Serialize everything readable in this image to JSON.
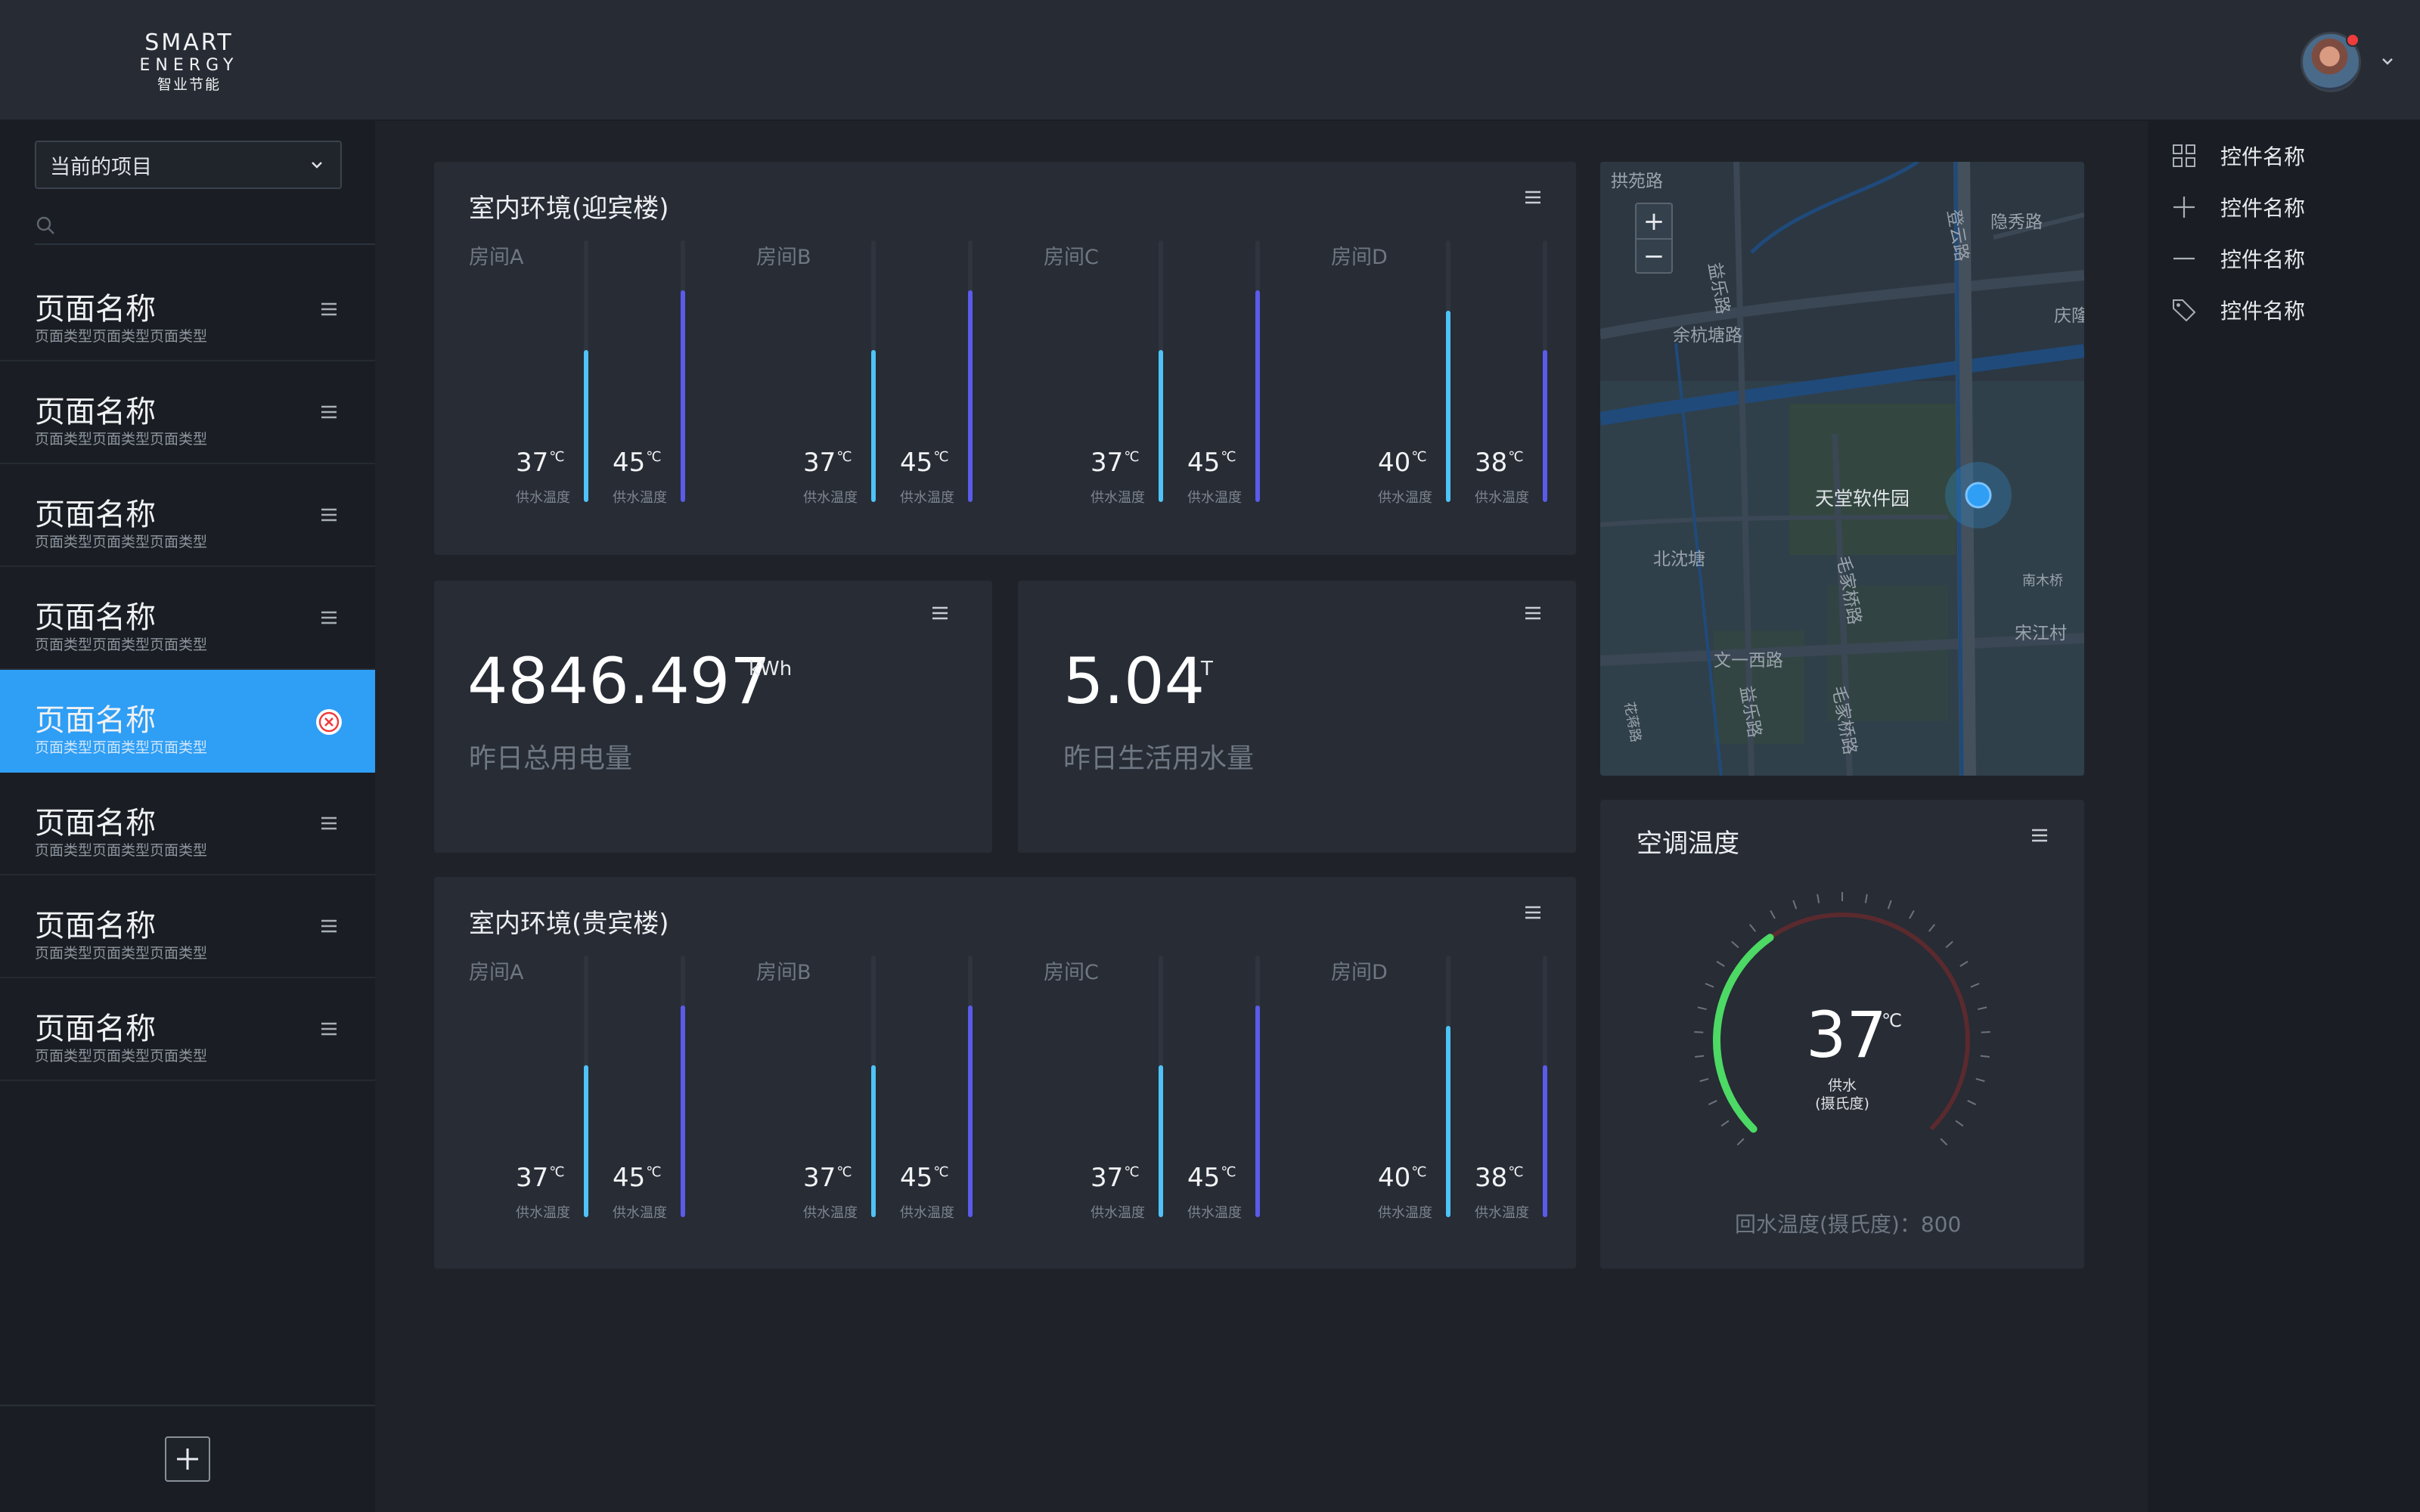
{
  "brand": {
    "line1": "SMART",
    "line2": "ENERGY",
    "line3": "智业节能"
  },
  "sidebar": {
    "project_select": "当前的项目",
    "search_placeholder": "",
    "items": [
      {
        "title": "页面名称",
        "subtitle": "页面类型页面类型页面类型"
      },
      {
        "title": "页面名称",
        "subtitle": "页面类型页面类型页面类型"
      },
      {
        "title": "页面名称",
        "subtitle": "页面类型页面类型页面类型"
      },
      {
        "title": "页面名称",
        "subtitle": "页面类型页面类型页面类型"
      },
      {
        "title": "页面名称",
        "subtitle": "页面类型页面类型页面类型",
        "active": true
      },
      {
        "title": "页面名称",
        "subtitle": "页面类型页面类型页面类型"
      },
      {
        "title": "页面名称",
        "subtitle": "页面类型页面类型页面类型"
      },
      {
        "title": "页面名称",
        "subtitle": "页面类型页面类型页面类型"
      }
    ]
  },
  "right_panel": {
    "items": [
      {
        "icon": "grid-icon",
        "label": "控件名称"
      },
      {
        "icon": "plus-icon",
        "label": "控件名称"
      },
      {
        "icon": "minus-icon",
        "label": "控件名称"
      },
      {
        "icon": "tag-icon",
        "label": "控件名称"
      }
    ]
  },
  "env_top": {
    "title": "室内环境(迎宾楼)",
    "rooms": [
      {
        "name": "房间A",
        "v1": "37",
        "v2": "45",
        "l1": "供水温度",
        "l2": "供水温度",
        "f1": 0.58,
        "f2": 0.81
      },
      {
        "name": "房间B",
        "v1": "37",
        "v2": "45",
        "l1": "供水温度",
        "l2": "供水温度",
        "f1": 0.58,
        "f2": 0.81
      },
      {
        "name": "房间C",
        "v1": "37",
        "v2": "45",
        "l1": "供水温度",
        "l2": "供水温度",
        "f1": 0.58,
        "f2": 0.81
      },
      {
        "name": "房间D",
        "v1": "40",
        "v2": "38",
        "l1": "供水温度",
        "l2": "供水温度",
        "f1": 0.73,
        "f2": 0.58
      }
    ]
  },
  "env_bottom": {
    "title": "室内环境(贵宾楼)",
    "rooms": [
      {
        "name": "房间A",
        "v1": "37",
        "v2": "45",
        "l1": "供水温度",
        "l2": "供水温度",
        "f1": 0.58,
        "f2": 0.81
      },
      {
        "name": "房间B",
        "v1": "37",
        "v2": "45",
        "l1": "供水温度",
        "l2": "供水温度",
        "f1": 0.58,
        "f2": 0.81
      },
      {
        "name": "房间C",
        "v1": "37",
        "v2": "45",
        "l1": "供水温度",
        "l2": "供水温度",
        "f1": 0.58,
        "f2": 0.81
      },
      {
        "name": "房间D",
        "v1": "40",
        "v2": "38",
        "l1": "供水温度",
        "l2": "供水温度",
        "f1": 0.73,
        "f2": 0.58
      }
    ]
  },
  "unit_c": "℃",
  "electricity": {
    "value": "4846.497",
    "unit": "kWh",
    "label": "昨日总用电量"
  },
  "water": {
    "value": "5.04",
    "unit": "T",
    "label": "昨日生活用水量"
  },
  "ac": {
    "title": "空调温度",
    "value": "37",
    "unit": "℃",
    "sub1": "供水",
    "sub2": "(摄氏度)",
    "footer": "回水温度(摄氏度)：800",
    "fraction": 0.37
  },
  "map": {
    "zoom_in": "+",
    "zoom_out": "−",
    "labels": [
      "拱苑路",
      "余杭塘路",
      "益乐路",
      "天堂软件园",
      "北沈塘",
      "毛家桥路",
      "文一西路",
      "宋江村",
      "庆隆",
      "隐秀路",
      "南木桥",
      "登云路",
      "益乐路",
      "毛家桥路",
      "花蒋路"
    ]
  },
  "colors": {
    "accent": "#2f9ef5",
    "bar_cyan": "#4fc3f7",
    "bar_indigo": "#5b5bea",
    "gauge_green": "#4cd964",
    "gauge_red": "#5a2a2e"
  }
}
